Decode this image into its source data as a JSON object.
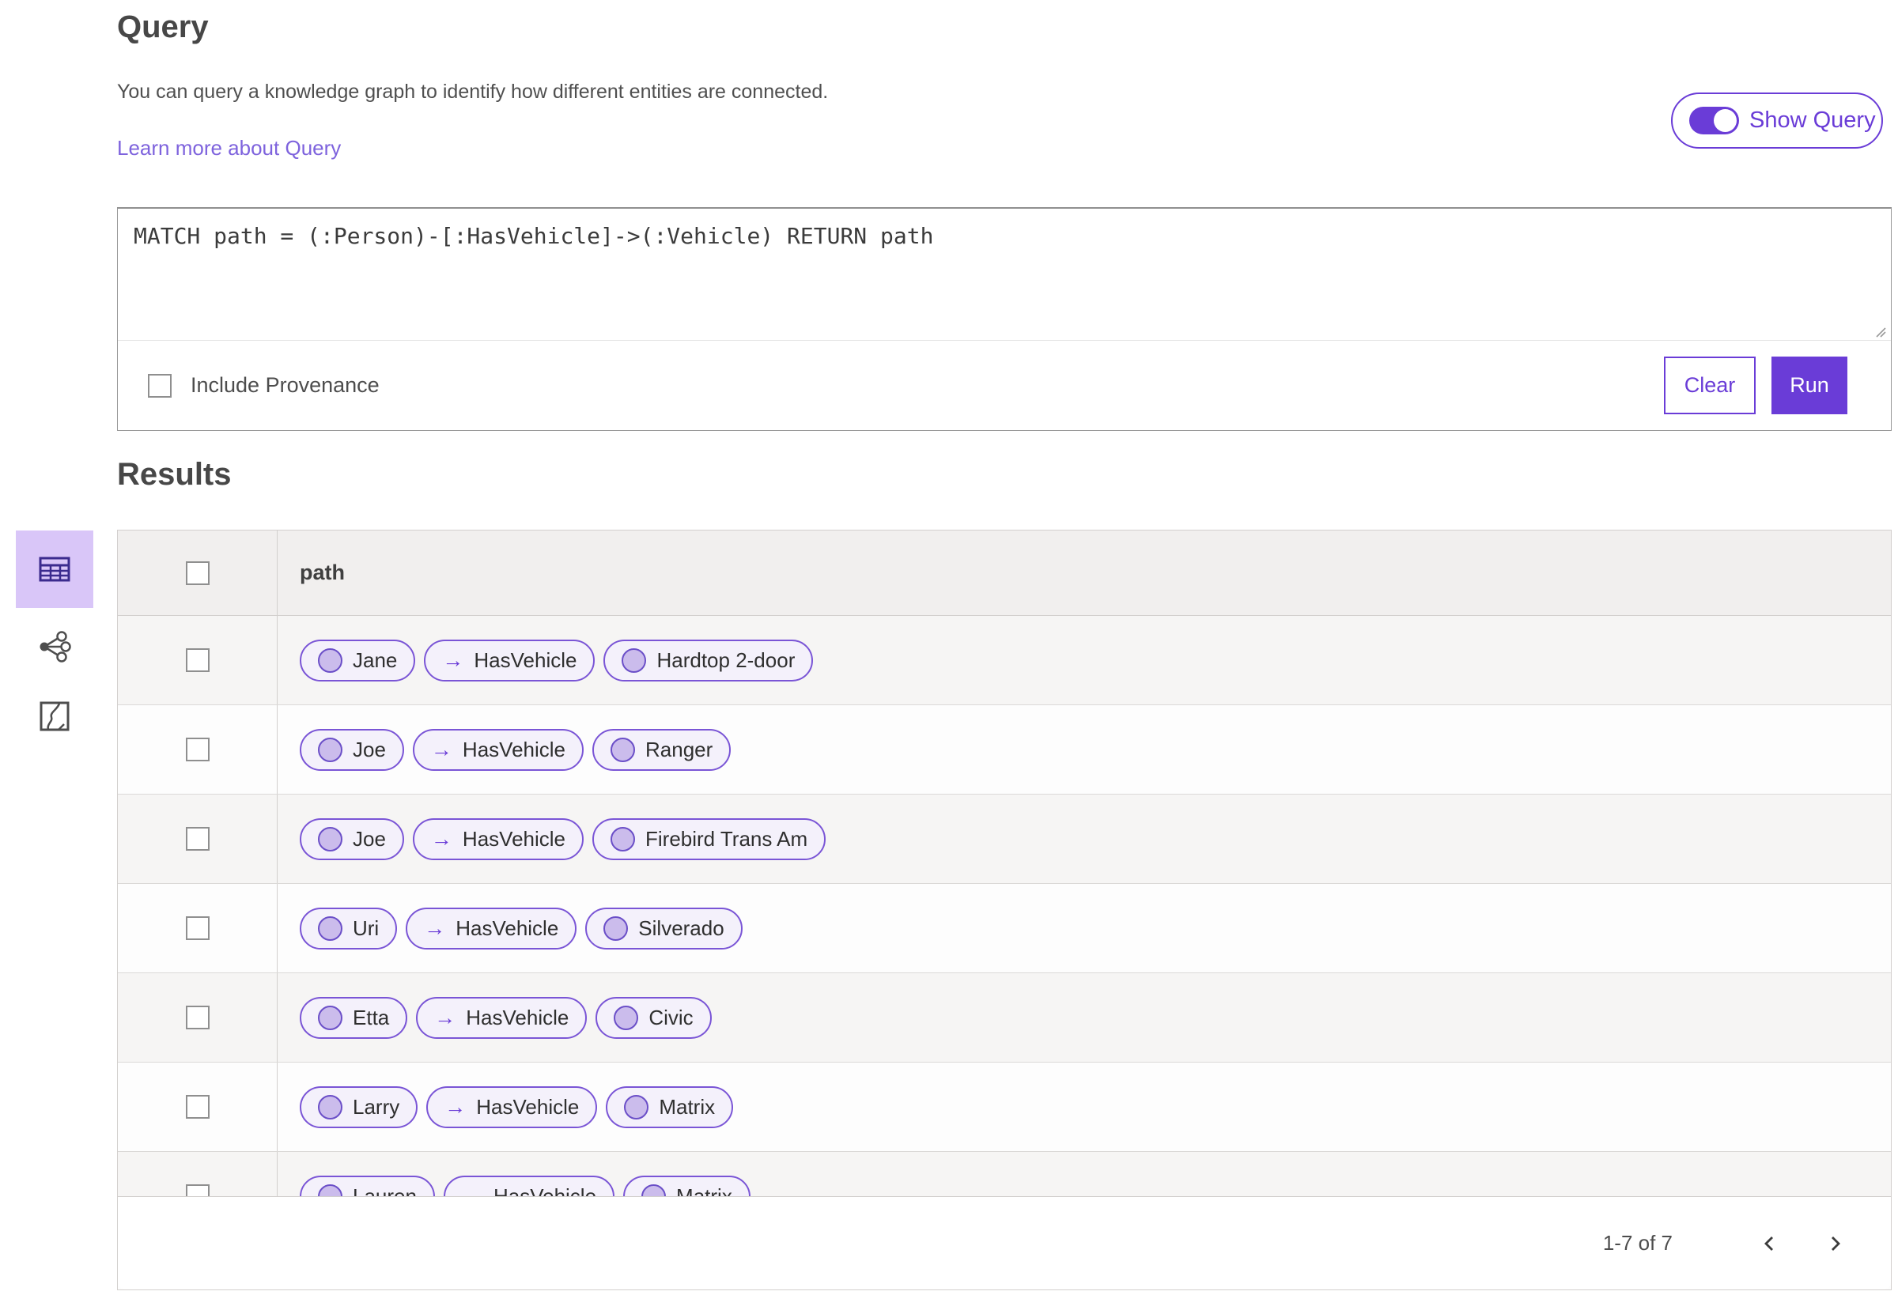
{
  "header": {
    "title": "Query",
    "description": "You can query a knowledge graph to identify how different entities are connected.",
    "learn_more_label": "Learn more about Query",
    "show_query_label": "Show Query",
    "show_query_on": true
  },
  "query_panel": {
    "query_text": "MATCH path = (:Person)-[:HasVehicle]->(:Vehicle) RETURN path",
    "include_provenance_label": "Include Provenance",
    "include_provenance_checked": false,
    "clear_label": "Clear",
    "run_label": "Run"
  },
  "results": {
    "title": "Results",
    "views": [
      {
        "icon": "table-view-icon",
        "selected": true
      },
      {
        "icon": "link-chart-view-icon",
        "selected": false
      },
      {
        "icon": "map-view-icon",
        "selected": false
      }
    ],
    "table": {
      "column_header": "path",
      "relation_arrow": "→",
      "rows": [
        {
          "source": "Jane",
          "relation": "HasVehicle",
          "target": "Hardtop 2-door"
        },
        {
          "source": "Joe",
          "relation": "HasVehicle",
          "target": "Ranger"
        },
        {
          "source": "Joe",
          "relation": "HasVehicle",
          "target": "Firebird Trans Am"
        },
        {
          "source": "Uri",
          "relation": "HasVehicle",
          "target": "Silverado"
        },
        {
          "source": "Etta",
          "relation": "HasVehicle",
          "target": "Civic"
        },
        {
          "source": "Larry",
          "relation": "HasVehicle",
          "target": "Matrix"
        },
        {
          "source": "Lauren",
          "relation": "HasVehicle",
          "target": "Matrix"
        }
      ]
    },
    "pagination": {
      "range_label": "1-7 of 7",
      "prev_icon": "chevron-left-icon",
      "next_icon": "chevron-right-icon"
    }
  },
  "colors": {
    "accent": "#6a3cd7",
    "accent_light": "#d9c6f8",
    "pill_border": "#7a55d6",
    "pill_bg": "#f4f1fb",
    "circle_fill": "#cbbcec",
    "circle_border": "#6b4fc8",
    "link": "#7e63dd"
  }
}
